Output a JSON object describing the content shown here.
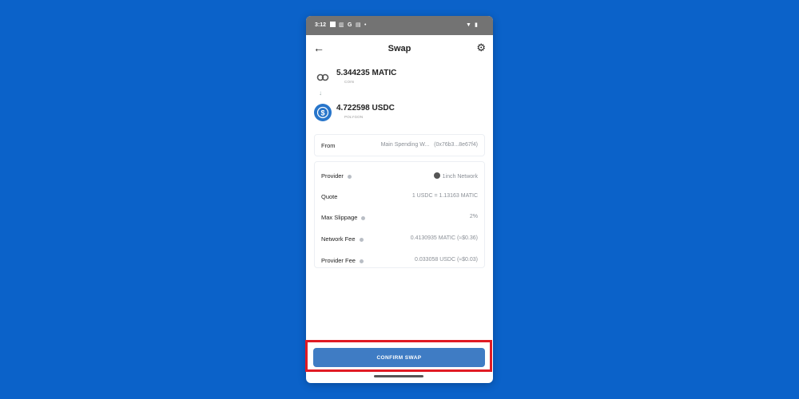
{
  "status_bar": {
    "time": "3:12",
    "icons": [
      "square-icon",
      "image-icon",
      "google-icon",
      "photo-icon",
      "dot-icon",
      "wifi-icon",
      "battery-icon"
    ],
    "google_glyph": "G"
  },
  "header": {
    "title": "Swap",
    "back_icon": "arrow-left-icon",
    "settings_icon": "gear-icon"
  },
  "swap": {
    "from_token": {
      "amount": "5.344235 MATIC",
      "network": "COIN",
      "icon": "polygon-icon"
    },
    "to_token": {
      "amount": "4.722598 USDC",
      "network": "POLYGON",
      "icon": "usdc-icon"
    }
  },
  "from": {
    "label": "From",
    "wallet": "Main Spending W...",
    "address": "(0x76b3...8e67f4)"
  },
  "details": [
    {
      "label": "Provider",
      "value": "1inch Network",
      "info": true
    },
    {
      "label": "Quote",
      "value": "1 USDC = 1.13163 MATIC",
      "info": false
    },
    {
      "label": "Max Slippage",
      "value": "2%",
      "info": true
    },
    {
      "label": "Network Fee",
      "value": "0.4130935 MATIC (≈$0.36)",
      "info": true
    },
    {
      "label": "Provider Fee",
      "value": "0.033058 USDC (≈$0.03)",
      "info": true
    }
  ],
  "action": {
    "confirm_label": "CONFIRM SWAP"
  },
  "colors": {
    "background": "#0b62c9",
    "button": "#3f7cc4",
    "highlight": "#e01b24"
  }
}
